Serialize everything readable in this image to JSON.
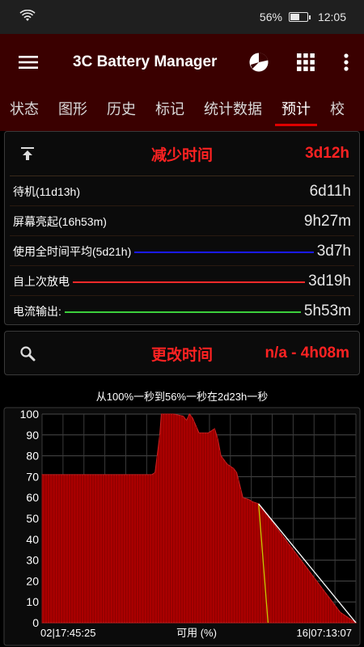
{
  "status": {
    "battery": "56%",
    "time": "12:05",
    "battery_level": 0.56
  },
  "appbar": {
    "title": "3C Battery Manager"
  },
  "tabs": [
    "状态",
    "图形",
    "历史",
    "标记",
    "统计数据",
    "预计",
    "校"
  ],
  "active_tab": 5,
  "decrease": {
    "title": "减少时间",
    "value": "3d12h",
    "rows": [
      {
        "label": "待机(11d13h)",
        "value": "6d11h",
        "line_color": ""
      },
      {
        "label": "屏幕亮起(16h53m)",
        "value": "9h27m",
        "line_color": ""
      },
      {
        "label": "使用全时间平均(5d21h)",
        "value": "3d7h",
        "line_color": "#1a1aff"
      },
      {
        "label": "自上次放电",
        "value": "3d19h",
        "line_color": "#ff2a2a"
      },
      {
        "label": "电流输出:",
        "value": "5h53m",
        "line_color": "#3ccf3c"
      }
    ]
  },
  "change": {
    "title": "更改时间",
    "value": "n/a - 4h08m"
  },
  "chart_data": {
    "type": "area",
    "title": "从100%一秒到56%一秒在2d23h一秒",
    "xlabel": "可用 (%)",
    "x_start_label": "02|17:45:25",
    "x_end_label": "16|07:13:07",
    "ylim": [
      0,
      100
    ],
    "yticks": [
      "100",
      "90",
      "80",
      "70",
      "60",
      "50",
      "40",
      "30",
      "20",
      "10",
      "0"
    ],
    "grid": true,
    "series": [
      {
        "color": "#aa0000",
        "x": [
          0.0,
          0.1,
          0.2,
          0.3,
          0.35,
          0.36,
          0.375,
          0.38,
          0.42,
          0.45,
          0.46,
          0.47,
          0.48,
          0.5,
          0.53,
          0.55,
          0.56,
          0.57,
          0.59,
          0.6,
          0.61,
          0.62,
          0.64,
          0.66,
          0.67,
          0.69,
          0.75,
          0.8,
          0.85,
          0.9,
          0.95,
          1.0
        ],
        "values": [
          71,
          71,
          71,
          71,
          71,
          72,
          90,
          100,
          100,
          99,
          97,
          100,
          98,
          91,
          91,
          93,
          88,
          80,
          76,
          75,
          74,
          72,
          60,
          59,
          58,
          57,
          45,
          35,
          25,
          15,
          5,
          0
        ]
      }
    ],
    "projections": [
      {
        "color": "#c8c800",
        "x": [
          0.69,
          0.72
        ],
        "values": [
          57,
          0
        ]
      },
      {
        "color": "#ffffff",
        "x": [
          0.69,
          1.0
        ],
        "values": [
          57,
          0
        ]
      }
    ]
  }
}
